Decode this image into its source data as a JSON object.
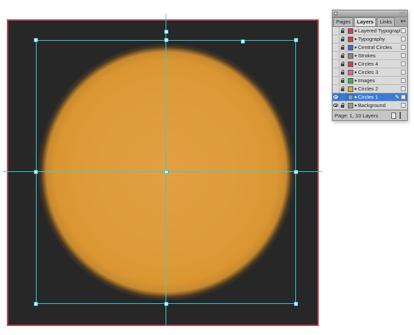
{
  "stage": {
    "artboard_fill": "#272727",
    "artboard_border": "#b8434e",
    "circle_fill": "#de9a38",
    "guide_color": "#2ed3d3",
    "selection_color": "#35cfe0"
  },
  "panel": {
    "tabs": [
      {
        "label": "Pages",
        "active": false
      },
      {
        "label": "Layers",
        "active": true
      },
      {
        "label": "Links",
        "active": false
      }
    ],
    "layers": [
      {
        "name": "Layered Typography",
        "color": "#cc4444",
        "visible": false,
        "locked": true,
        "selected": false
      },
      {
        "name": "Typography",
        "color": "#cc4444",
        "visible": false,
        "locked": true,
        "selected": false
      },
      {
        "name": "Central Circles",
        "color": "#4466cc",
        "visible": false,
        "locked": true,
        "selected": false
      },
      {
        "name": "Strokes",
        "color": "#888888",
        "visible": false,
        "locked": true,
        "selected": false
      },
      {
        "name": "Circles 4",
        "color": "#cc4444",
        "visible": false,
        "locked": true,
        "selected": false
      },
      {
        "name": "Circles 3",
        "color": "#dd66aa",
        "visible": false,
        "locked": true,
        "selected": false
      },
      {
        "name": "Images",
        "color": "#44aa55",
        "visible": false,
        "locked": true,
        "selected": false
      },
      {
        "name": "Circles 2",
        "color": "#ddaa33",
        "visible": false,
        "locked": true,
        "selected": false
      },
      {
        "name": "Circles 1",
        "color": "#66aadd",
        "visible": true,
        "locked": false,
        "selected": true
      },
      {
        "name": "Background",
        "color": "#999999",
        "visible": true,
        "locked": true,
        "selected": false
      }
    ],
    "status": "Page: 1, 10 Layers"
  }
}
